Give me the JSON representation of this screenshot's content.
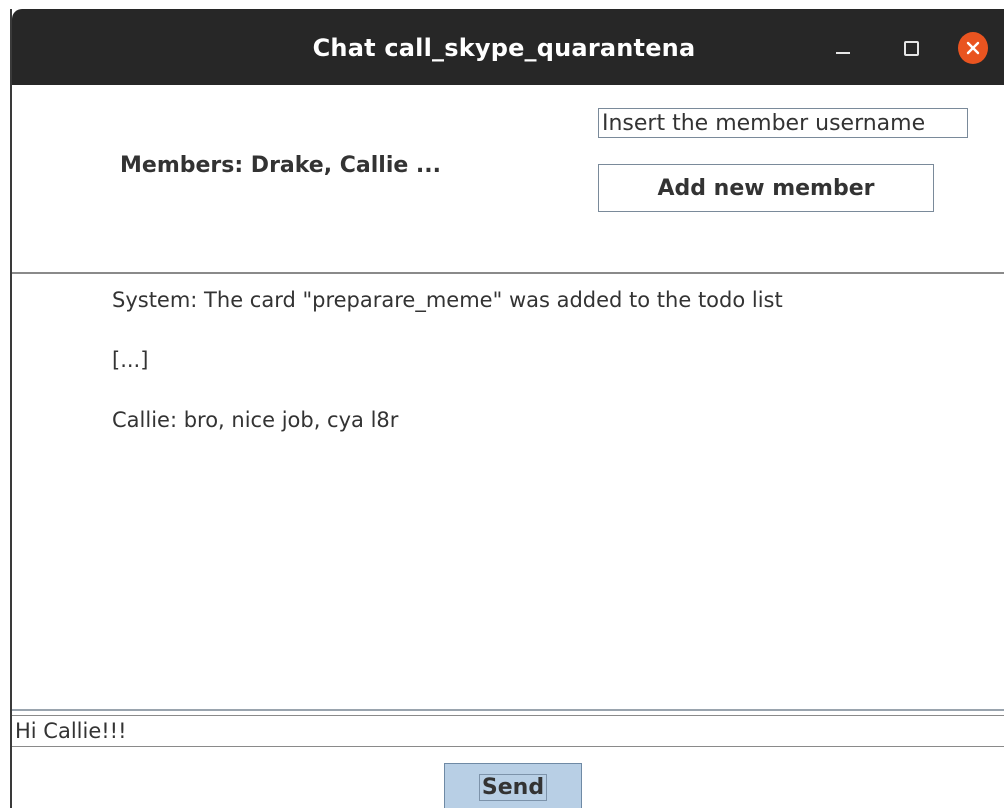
{
  "window": {
    "title": "Chat call_skype_quarantena"
  },
  "header": {
    "members_label": "Members: Drake, Callie ...",
    "member_input_placeholder": "Insert the member username",
    "add_member_label": "Add new member"
  },
  "chat": {
    "messages": [
      "System: The card \"preparare_meme\" was added to the todo list",
      "[...]",
      "Callie: bro, nice job, cya l8r"
    ]
  },
  "composer": {
    "message_value": "Hi Callie!!!",
    "send_label": "Send"
  },
  "colors": {
    "titlebar": "#272727",
    "close_button": "#e95420",
    "send_button": "#b8cfe5"
  },
  "icons": {
    "minimize": "minimize-icon",
    "maximize": "maximize-icon",
    "close": "close-icon"
  }
}
